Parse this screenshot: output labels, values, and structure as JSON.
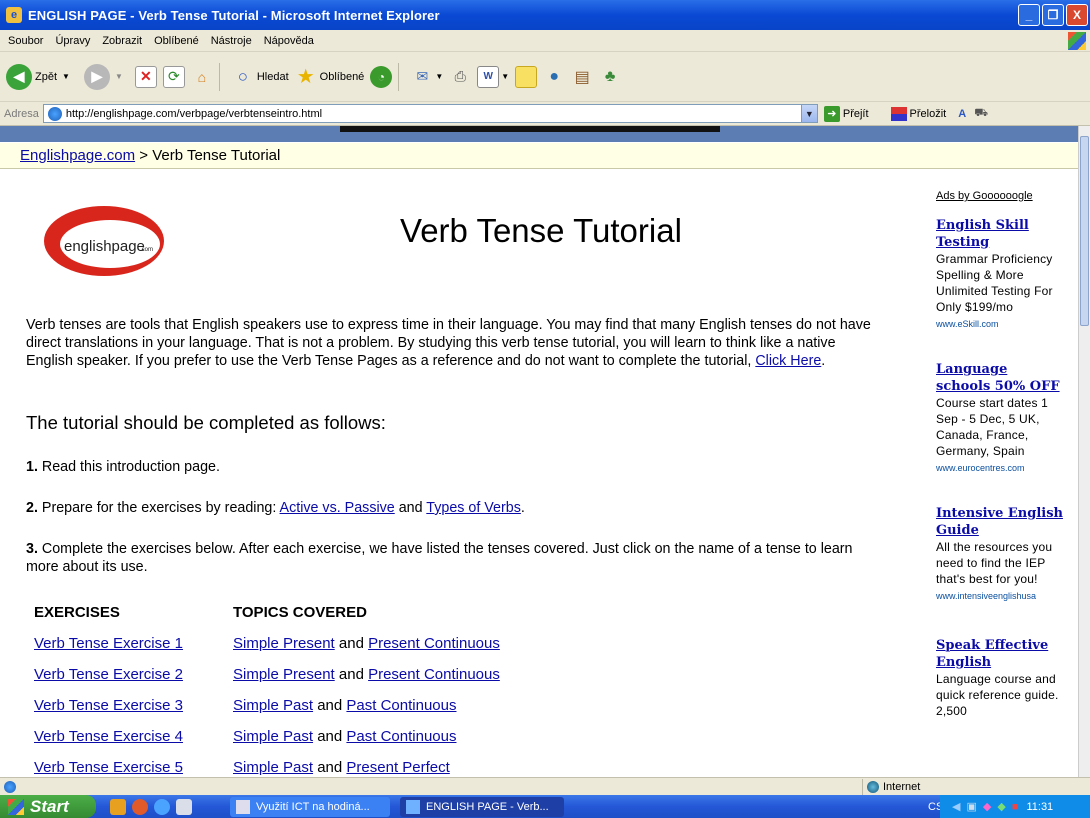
{
  "window": {
    "title": "ENGLISH PAGE - Verb Tense Tutorial - Microsoft Internet Explorer",
    "app_icon": "ie-icon",
    "minimize": "_",
    "restore": "❐",
    "close": "X"
  },
  "menu": [
    "Soubor",
    "Úpravy",
    "Zobrazit",
    "Oblíbené",
    "Nástroje",
    "Nápověda"
  ],
  "toolbar": {
    "back": "Zpět",
    "search": "Hledat",
    "favorites": "Oblíbené"
  },
  "address": {
    "label": "Adresa",
    "url": "http://englishpage.com/verbpage/verbtenseintro.html",
    "go": "Přejít",
    "translate": "Přeložit"
  },
  "breadcrumb": {
    "home": "Englishpage.com",
    "separator": " > ",
    "current": "Verb Tense Tutorial"
  },
  "logo_text": "englishpage",
  "logo_suffix": ".com",
  "page_title": "Verb Tense Tutorial",
  "intro": {
    "text": "Verb tenses are tools that English speakers use to express time in their language. You may find that many English tenses do not have direct translations in your language. That is not a problem. By studying this verb tense tutorial, you will learn to think like a native English speaker. If you prefer to use the Verb Tense Pages as a reference and do not want to complete the tutorial, ",
    "link": "Click Here",
    "end": "."
  },
  "tutorial_heading": "The tutorial should be completed as follows:",
  "steps": {
    "s1_num": "1.",
    "s1_text": " Read this introduction page.",
    "s2_num": "2.",
    "s2_text": " Prepare for the exercises by reading: ",
    "s2_link1": "Active vs. Passive",
    "s2_and": " and ",
    "s2_link2": "Types of Verbs",
    "s2_end": ".",
    "s3_num": "3.",
    "s3_text": " Complete the exercises below. After each exercise, we have listed the tenses covered. Just click on the name of a tense to learn more about its use."
  },
  "table": {
    "col1": "EXERCISES",
    "col2": "TOPICS COVERED",
    "rows": [
      {
        "exercise": "Verb Tense Exercise 1",
        "t1": "Simple Present",
        "and": " and ",
        "t2": "Present Continuous"
      },
      {
        "exercise": "Verb Tense Exercise 2",
        "t1": "Simple Present",
        "and": " and ",
        "t2": "Present Continuous"
      },
      {
        "exercise": "Verb Tense Exercise 3",
        "t1": "Simple Past",
        "and": " and ",
        "t2": "Past Continuous"
      },
      {
        "exercise": "Verb Tense Exercise 4",
        "t1": "Simple Past",
        "and": " and ",
        "t2": "Past Continuous"
      },
      {
        "exercise": "Verb Tense Exercise 5",
        "t1": "Simple Past",
        "and": " and ",
        "t2": "Present Perfect"
      }
    ]
  },
  "ads": {
    "header": "Ads by Goooooogle",
    "items": [
      {
        "title": "English Skill Testing",
        "body": "Grammar Proficiency Spelling & More Unlimited Testing For Only $199/mo",
        "url": "www.eSkill.com"
      },
      {
        "title": "Language schools 50% OFF",
        "body": "Course start dates 1 Sep - 5 Dec, 5 UK, Canada, France, Germany, Spain",
        "url": "www.eurocentres.com"
      },
      {
        "title": "Intensive English Guide",
        "body": "All the resources you need to find the IEP that's best for you!",
        "url": "www.intensiveenglishusa"
      },
      {
        "title": "Speak Effective English",
        "body": "Language course and quick reference guide. 2,500",
        "url": ""
      }
    ]
  },
  "status": {
    "zone": "Internet"
  },
  "taskbar": {
    "start": "Start",
    "task1": "Využití ICT na hodiná...",
    "task2": "ENGLISH PAGE - Verb...",
    "lang": "CS",
    "clock": "11:31"
  }
}
